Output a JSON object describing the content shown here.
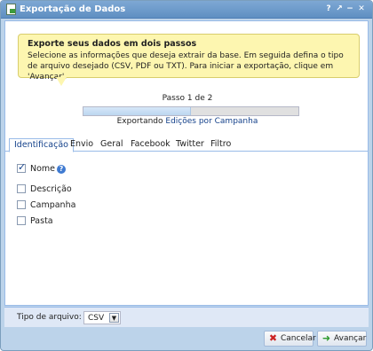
{
  "window": {
    "title": "Exportação de Dados",
    "controls": [
      "?",
      "↗",
      "−",
      "✕"
    ]
  },
  "tip": {
    "title": "Exporte seus dados em dois passos",
    "body": "Selecione as informações que deseja extrair da base. Em seguida defina o tipo de arquivo desejado (CSV, PDF ou TXT). Para iniciar a exportação, clique em 'Avançar'."
  },
  "progress": {
    "step_label": "Passo 1 de 2",
    "fraction": 0.5,
    "exporting_prefix": "Exportando",
    "exporting_target": "Edições por Campanha"
  },
  "tabs": [
    {
      "label": "Identificação",
      "active": true
    },
    {
      "label": "Envio",
      "active": false
    },
    {
      "label": "Geral",
      "active": false
    },
    {
      "label": "Facebook",
      "active": false
    },
    {
      "label": "Twitter",
      "active": false
    },
    {
      "label": "Filtro",
      "active": false
    }
  ],
  "fields": [
    {
      "label": "Nome",
      "checked": true,
      "help": true
    },
    {
      "label": "Descrição",
      "checked": false
    },
    {
      "label": "Campanha",
      "checked": false
    },
    {
      "label": "Pasta",
      "checked": false
    }
  ],
  "footer": {
    "file_type_label": "Tipo de arquivo:",
    "file_type_value": "CSV"
  },
  "buttons": {
    "cancel": "Cancelar",
    "next": "Avançar"
  },
  "colors": {
    "accent": "#15428b",
    "title_bar": "#6b98c9",
    "tip_background": "#fdf6b0",
    "cancel_icon": "#cc2222",
    "next_icon": "#2e9a2e"
  }
}
